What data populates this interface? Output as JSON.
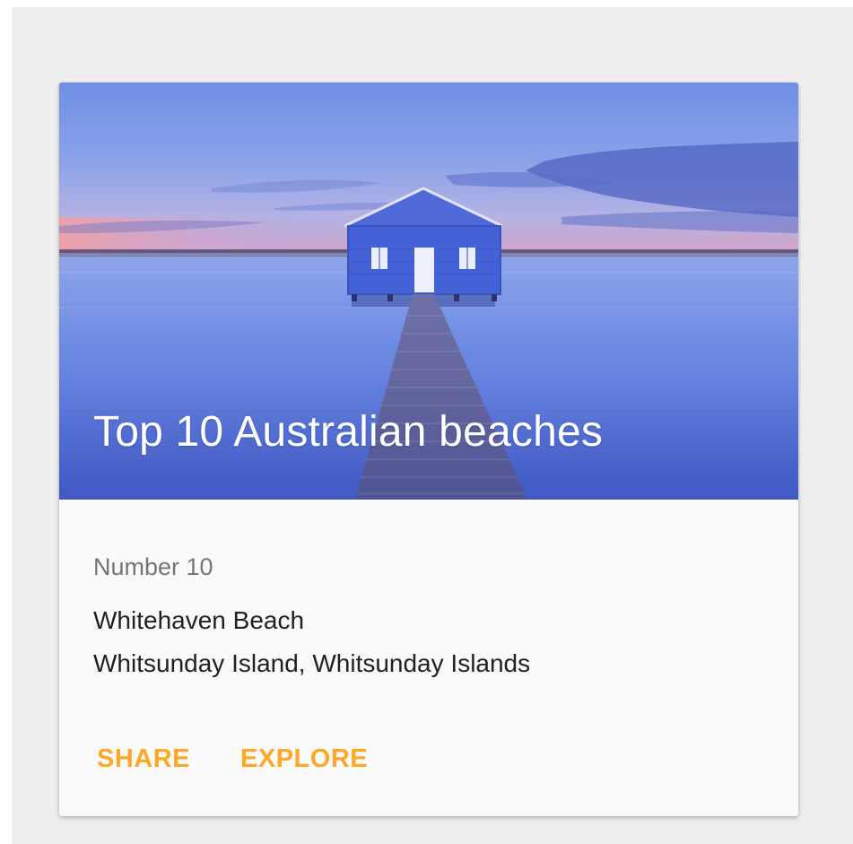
{
  "card": {
    "title": "Top 10 Australian beaches",
    "subhead": "Number 10",
    "body_lines": [
      "Whitehaven Beach",
      "Whitsunday Island, Whitsunday Islands"
    ],
    "actions": [
      {
        "label": "SHARE"
      },
      {
        "label": "EXPLORE"
      }
    ],
    "accent_color": "#ffa726",
    "image_subject": "blue boathouse on a pier over calm water at dusk"
  }
}
